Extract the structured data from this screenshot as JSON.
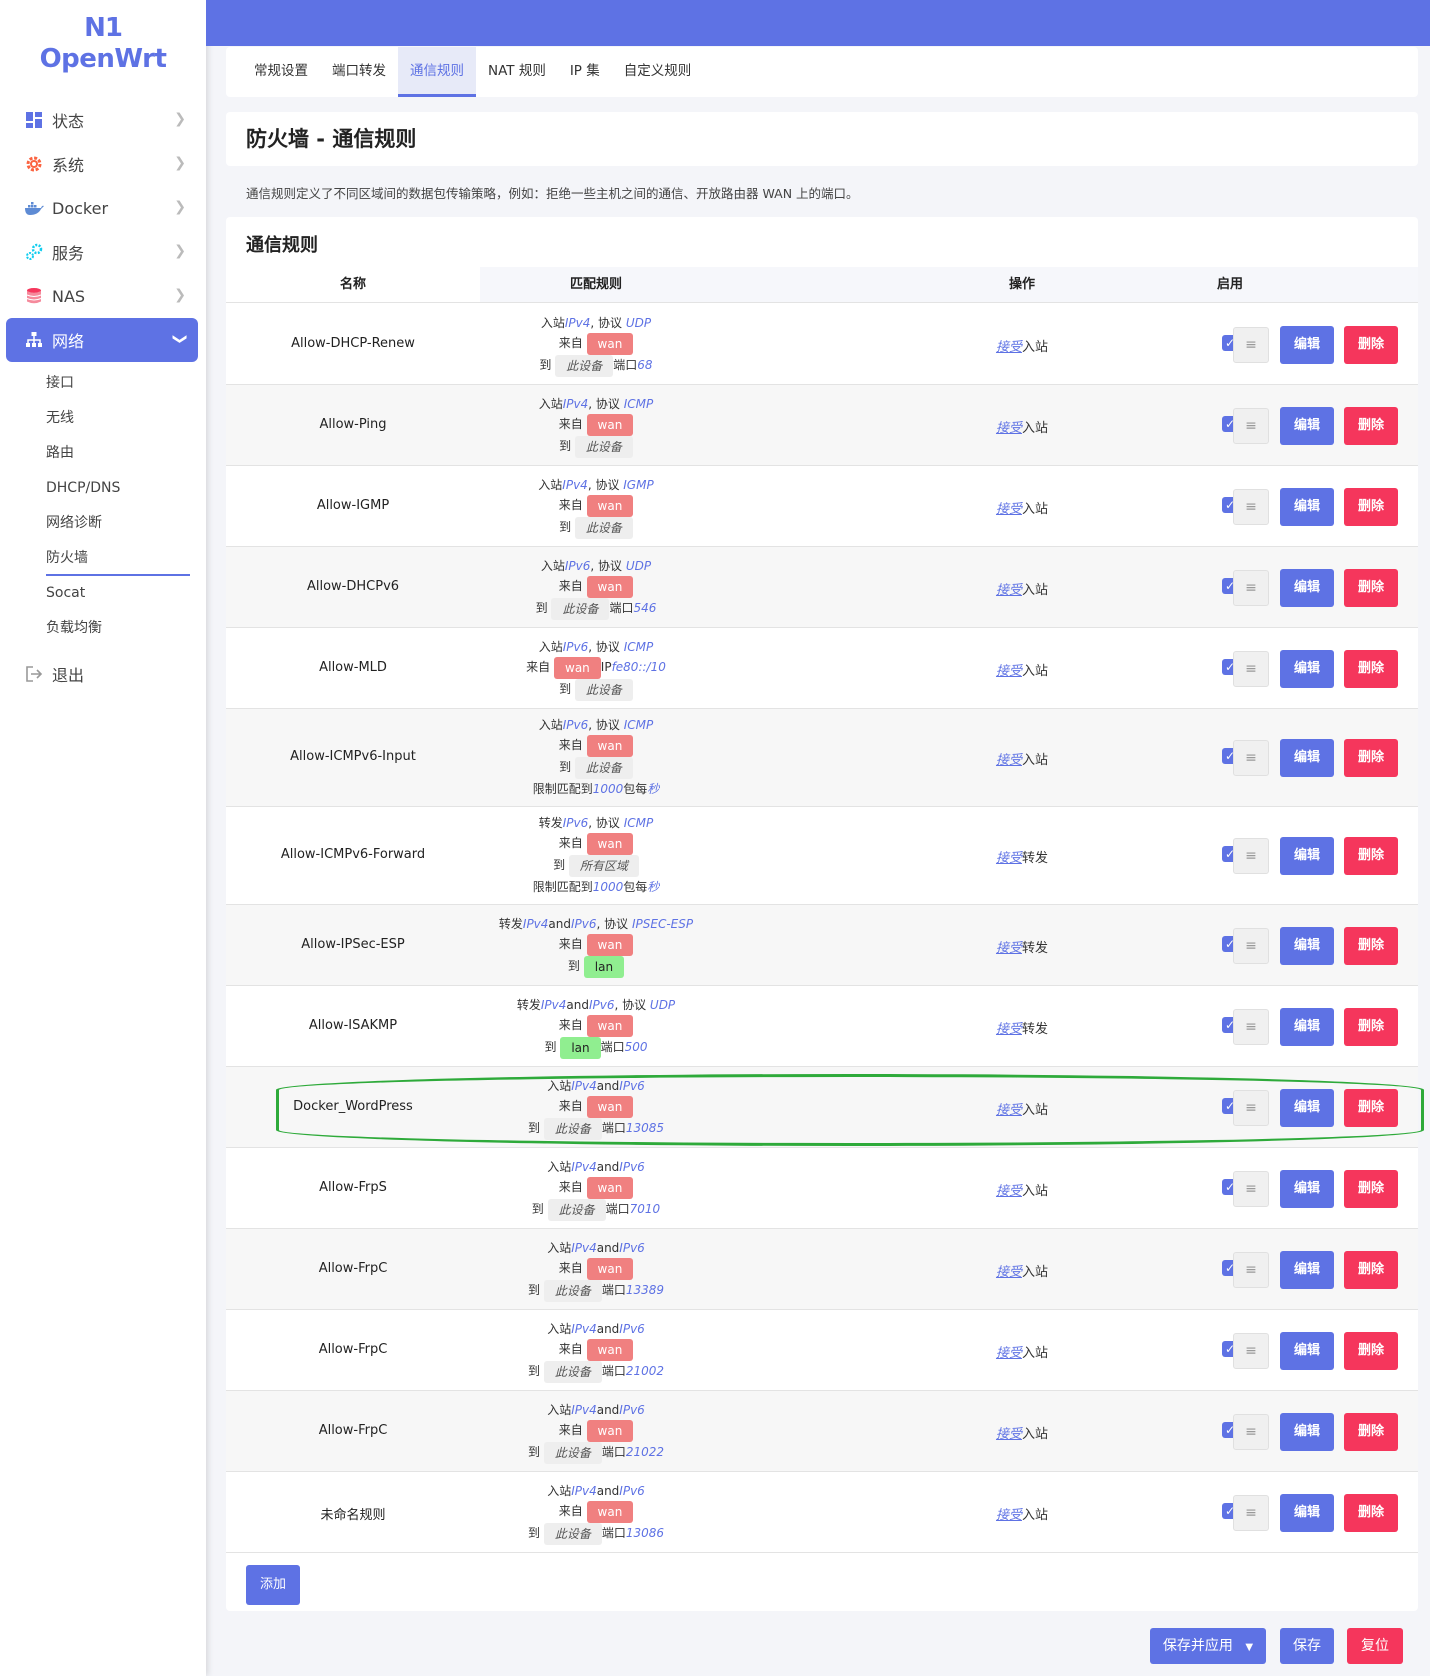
{
  "brand": {
    "mark": "N1",
    "name": "OpenWrt"
  },
  "sidebar": {
    "items": [
      {
        "label": "状态",
        "icon": "dashboard-icon"
      },
      {
        "label": "系统",
        "icon": "gear-icon"
      },
      {
        "label": "Docker",
        "icon": "docker-icon"
      },
      {
        "label": "服务",
        "icon": "services-icon"
      },
      {
        "label": "NAS",
        "icon": "database-icon"
      },
      {
        "label": "网络",
        "icon": "network-icon"
      }
    ],
    "submenu": [
      "接口",
      "无线",
      "路由",
      "DHCP/DNS",
      "网络诊断",
      "防火墙",
      "Socat",
      "负载均衡"
    ],
    "logout": "退出"
  },
  "tabs": [
    "常规设置",
    "端口转发",
    "通信规则",
    "NAT 规则",
    "IP 集",
    "自定义规则"
  ],
  "page_title": "防火墙 - 通信规则",
  "description": "通信规则定义了不同区域间的数据包传输策略，例如：拒绝一些主机之间的通信、开放路由器 WAN 上的端口。",
  "section_title": "通信规则",
  "columns": {
    "name": "名称",
    "match": "匹配规则",
    "action": "操作",
    "enabled": "启用"
  },
  "labels": {
    "from": "来自",
    "to": "到",
    "port": "端口",
    "and": "and",
    "ip": "IP",
    "accept": "接受",
    "limit_prefix": "限制匹配到",
    "limit_mid": "包每",
    "edit": "编辑",
    "delete": "删除",
    "drag": "≡",
    "check": "✓"
  },
  "rules": [
    {
      "name": "Allow-DHCP-Renew",
      "dir": "入站",
      "fam": [
        "IPv4"
      ],
      "proto": "UDP",
      "from": "wan",
      "to": "此设备",
      "to_type": "dev",
      "port": "68",
      "action": "入站"
    },
    {
      "name": "Allow-Ping",
      "dir": "入站",
      "fam": [
        "IPv4"
      ],
      "proto": "ICMP",
      "from": "wan",
      "to": "此设备",
      "to_type": "dev",
      "action": "入站"
    },
    {
      "name": "Allow-IGMP",
      "dir": "入站",
      "fam": [
        "IPv4"
      ],
      "proto": "IGMP",
      "from": "wan",
      "to": "此设备",
      "to_type": "dev",
      "action": "入站"
    },
    {
      "name": "Allow-DHCPv6",
      "dir": "入站",
      "fam": [
        "IPv6"
      ],
      "proto": "UDP",
      "from": "wan",
      "to": "此设备",
      "to_type": "dev",
      "port": "546",
      "action": "入站"
    },
    {
      "name": "Allow-MLD",
      "dir": "入站",
      "fam": [
        "IPv6"
      ],
      "proto": "ICMP",
      "from": "wan",
      "from_ip": "fe80::/10",
      "to": "此设备",
      "to_type": "dev",
      "action": "入站"
    },
    {
      "name": "Allow-ICMPv6-Input",
      "dir": "入站",
      "fam": [
        "IPv6"
      ],
      "proto": "ICMP",
      "from": "wan",
      "to": "此设备",
      "to_type": "dev",
      "limit": "1000",
      "limit_unit": "秒",
      "action": "入站"
    },
    {
      "name": "Allow-ICMPv6-Forward",
      "dir": "转发",
      "fam": [
        "IPv6"
      ],
      "proto": "ICMP",
      "from": "wan",
      "to": "所有区域",
      "to_type": "dev",
      "limit": "1000",
      "limit_unit": "秒",
      "action": "转发"
    },
    {
      "name": "Allow-IPSec-ESP",
      "dir": "转发",
      "fam": [
        "IPv4",
        "IPv6"
      ],
      "proto": "IPSEC-ESP",
      "from": "wan",
      "to": "lan",
      "to_type": "lan",
      "action": "转发"
    },
    {
      "name": "Allow-ISAKMP",
      "dir": "转发",
      "fam": [
        "IPv4",
        "IPv6"
      ],
      "proto": "UDP",
      "from": "wan",
      "to": "lan",
      "to_type": "lan",
      "port": "500",
      "action": "转发"
    },
    {
      "name": "Docker_WordPress",
      "dir": "入站",
      "fam": [
        "IPv4",
        "IPv6"
      ],
      "from": "wan",
      "to": "此设备",
      "to_type": "dev",
      "port": "13085",
      "action": "入站"
    },
    {
      "name": "Allow-FrpS",
      "dir": "入站",
      "fam": [
        "IPv4",
        "IPv6"
      ],
      "from": "wan",
      "to": "此设备",
      "to_type": "dev",
      "port": "7010",
      "action": "入站"
    },
    {
      "name": "Allow-FrpC",
      "dir": "入站",
      "fam": [
        "IPv4",
        "IPv6"
      ],
      "from": "wan",
      "to": "此设备",
      "to_type": "dev",
      "port": "13389",
      "action": "入站"
    },
    {
      "name": "Allow-FrpC",
      "dir": "入站",
      "fam": [
        "IPv4",
        "IPv6"
      ],
      "from": "wan",
      "to": "此设备",
      "to_type": "dev",
      "port": "21002",
      "action": "入站"
    },
    {
      "name": "Allow-FrpC",
      "dir": "入站",
      "fam": [
        "IPv4",
        "IPv6"
      ],
      "from": "wan",
      "to": "此设备",
      "to_type": "dev",
      "port": "21022",
      "action": "入站"
    },
    {
      "name": "未命名规则",
      "dir": "入站",
      "fam": [
        "IPv4",
        "IPv6"
      ],
      "from": "wan",
      "to": "此设备",
      "to_type": "dev",
      "port": "13086",
      "action": "入站"
    }
  ],
  "buttons": {
    "add": "添加",
    "save_apply": "保存并应用",
    "save": "保存",
    "reset": "复位"
  },
  "colors": {
    "accent": "#5e72e4",
    "danger": "#f5365c",
    "wan": "#f08080",
    "lan": "#90ee90",
    "highlight": "#2eaa3a"
  }
}
